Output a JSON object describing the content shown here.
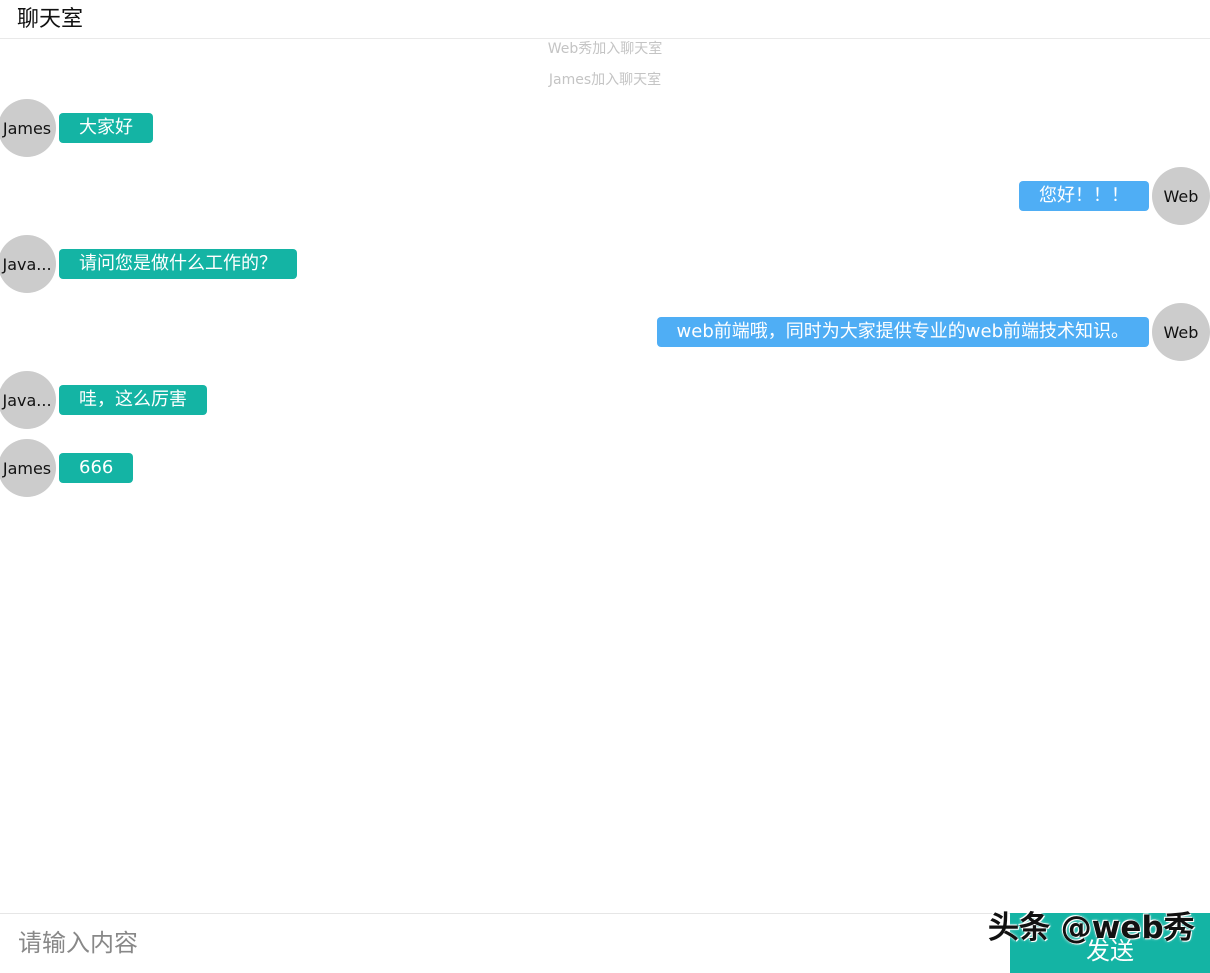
{
  "header": {
    "title": "聊天室"
  },
  "system_messages": [
    "Web秀加入聊天室",
    "James加入聊天室"
  ],
  "messages": [
    {
      "side": "left",
      "avatar": "James",
      "text": "大家好",
      "color": "#14b4a4"
    },
    {
      "side": "right",
      "avatar": "Web",
      "text": "您好！！！",
      "color": "#4faef5"
    },
    {
      "side": "left",
      "avatar": "Java...",
      "text": "请问您是做什么工作的？",
      "color": "#14b4a4"
    },
    {
      "side": "right",
      "avatar": "Web",
      "text": "web前端哦，同时为大家提供专业的web前端技术知识。",
      "color": "#4faef5"
    },
    {
      "side": "left",
      "avatar": "Java...",
      "text": "哇，这么厉害",
      "color": "#14b4a4"
    },
    {
      "side": "left",
      "avatar": "James",
      "text": "666",
      "color": "#14b4a4"
    }
  ],
  "composer": {
    "placeholder": "请输入内容",
    "send_label": "发送"
  },
  "watermark": {
    "text": "头条 @web秀"
  },
  "colors": {
    "accent": "#14b4a4",
    "self_bubble": "#4faef5",
    "avatar_bg": "#cccccc",
    "system_text": "#c4c4c4"
  }
}
